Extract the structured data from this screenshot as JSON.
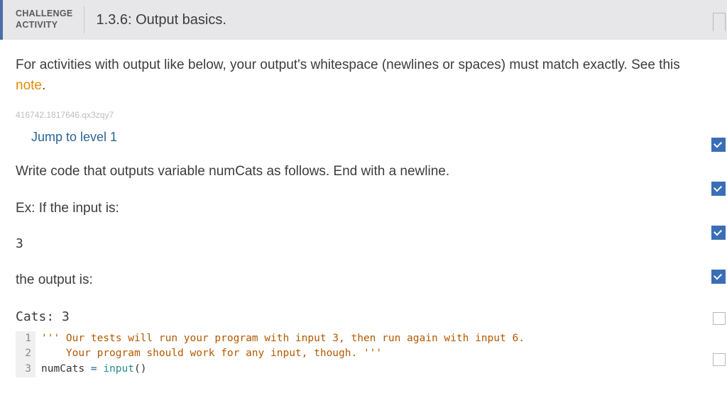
{
  "header": {
    "labelLine1": "CHALLENGE",
    "labelLine2": "ACTIVITY",
    "title": "1.3.6: Output basics."
  },
  "intro": {
    "text1": "For activities with output like below, your output's whitespace (newlines or spaces) must match exactly. See this ",
    "noteLink": "note",
    "text2": "."
  },
  "trackingId": "416742.1817646.qx3zqy7",
  "jumpLink": "Jump to level 1",
  "instruction": "Write code that outputs variable numCats as follows. End with a newline.",
  "exLabel": "Ex: If the input is:",
  "exInput": "3",
  "outputLabel": "the output is:",
  "exOutput": "Cats: 3",
  "code": {
    "lines": [
      {
        "num": "1",
        "segments": [
          {
            "cls": "str",
            "text": "''' Our tests will run your program with input 3, then run again with input 6."
          }
        ]
      },
      {
        "num": "2",
        "segments": [
          {
            "cls": "str",
            "text": "    Your program should work for any input, though. '''"
          }
        ]
      },
      {
        "num": "3",
        "segments": [
          {
            "cls": "",
            "text": "numCats "
          },
          {
            "cls": "kw",
            "text": "="
          },
          {
            "cls": "",
            "text": " "
          },
          {
            "cls": "fn",
            "text": "input"
          },
          {
            "cls": "",
            "text": "()"
          }
        ]
      }
    ]
  }
}
